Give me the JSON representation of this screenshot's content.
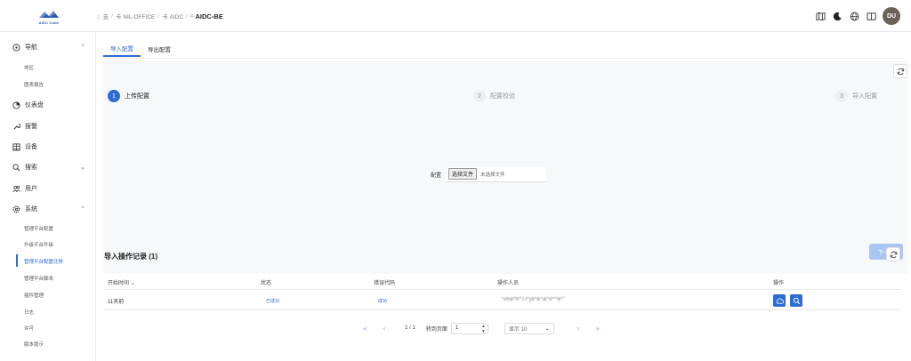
{
  "logo": {
    "text": "AIDC Cube"
  },
  "breadcrumb": {
    "items": [
      "♤ 吉",
      "卡 NIL-OFFICE",
      "卡 AIDC"
    ],
    "current": "AIDC-BE"
  },
  "header": {
    "avatar_initials": "DU"
  },
  "sidebar": {
    "nav": {
      "label": "导航",
      "subs": [
        "地区",
        "图表报告"
      ]
    },
    "dashboard": {
      "label": "仪表盘"
    },
    "alarm": {
      "label": "报警"
    },
    "device": {
      "label": "设备"
    },
    "search": {
      "label": "搜索"
    },
    "user": {
      "label": "用户"
    },
    "system": {
      "label": "系统",
      "subs": [
        "管理平台配置",
        "升级平台升级",
        "管理平台配置迁移",
        "管理平台脚本",
        "插件管理",
        "日志",
        "许可",
        "版本提示"
      ]
    }
  },
  "tabs": {
    "import": "导入配置",
    "export": "导出配置"
  },
  "steps": [
    {
      "num": "1",
      "label": "上传配置"
    },
    {
      "num": "2",
      "label": "配置校验"
    },
    {
      "num": "3",
      "label": "导入配置"
    }
  ],
  "upload": {
    "label": "配置",
    "button": "选择文件",
    "no_file": "未选择文件"
  },
  "next_button": "下一步",
  "records": {
    "title": "导入操作记录 (1)",
    "columns": [
      "开始时间",
      "状态",
      "错误代码",
      "操作人员",
      "操作"
    ],
    "rows": [
      {
        "time": "11天前",
        "status": "已成功",
        "code": "成功",
        "operator": "\"sha*h*Tl*jd*e*a*it**e*\""
      }
    ]
  },
  "pager": {
    "page_info": "1 / 1",
    "goto_label": "转到页面",
    "goto_value": "1",
    "page_size": "显示 10"
  },
  "colors": {
    "accent": "#2d6bd6",
    "next_disabled": "#a8c6f2"
  }
}
